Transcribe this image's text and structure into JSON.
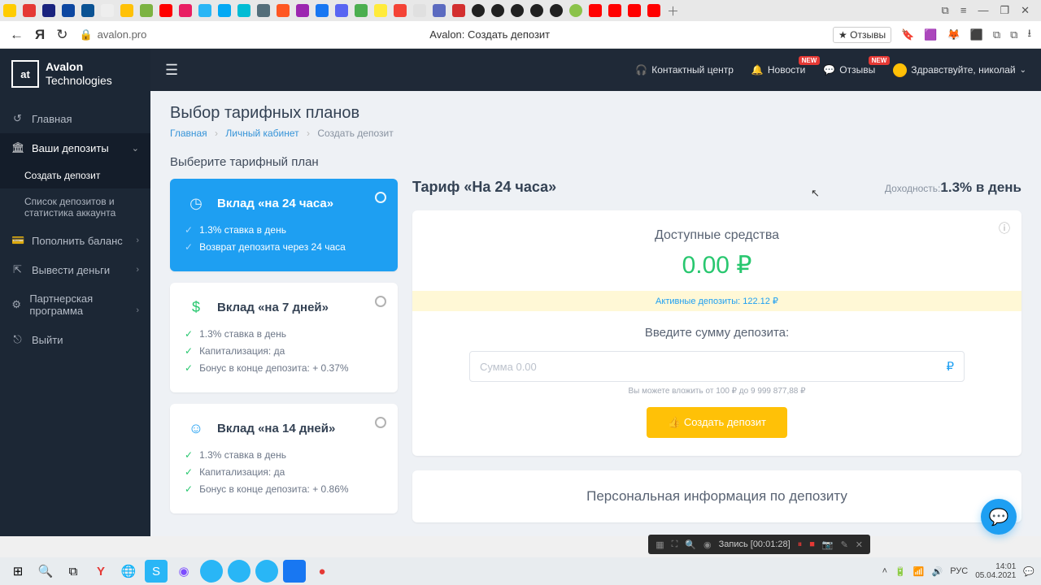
{
  "browser": {
    "address_domain": "avalon.pro",
    "page_title": "Avalon: Создать депозит",
    "reviews_button": "★ Отзывы"
  },
  "app_brand": {
    "line1": "Avalon",
    "line2": "Technologies",
    "logo_text": "at"
  },
  "topbar": {
    "contact": "Контактный центр",
    "news": "Новости",
    "reviews": "Отзывы",
    "badge": "NEW",
    "greeting": "Здравствуйте, николай"
  },
  "sidebar": {
    "home": "Главная",
    "deposits": "Ваши депозиты",
    "create_deposit": "Создать депозит",
    "deposit_list": "Список депозитов и статистика аккаунта",
    "topup": "Пополнить баланс",
    "withdraw": "Вывести деньги",
    "partner": "Партнерская программа",
    "logout": "Выйти"
  },
  "page": {
    "h1": "Выбор тарифных планов",
    "bc_home": "Главная",
    "bc_cabinet": "Личный кабинет",
    "bc_current": "Создать депозит",
    "section_label": "Выберите тарифный план"
  },
  "plans": [
    {
      "title": "Вклад «на 24 часа»",
      "features": [
        "1.3% ставка в день",
        "Возврат депозита через 24 часа"
      ]
    },
    {
      "title": "Вклад «на 7 дней»",
      "features": [
        "1.3% ставка в день",
        "Капитализация: да",
        "Бонус в конце депозита: + 0.37%"
      ]
    },
    {
      "title": "Вклад «на 14 дней»",
      "features": [
        "1.3% ставка в день",
        "Капитализация: да",
        "Бонус в конце депозита: + 0.86%"
      ]
    }
  ],
  "detail": {
    "tariff_title": "Тариф «На 24 часа»",
    "profit_label": "Доходность:",
    "profit_value": "1.3% в день",
    "funds_label": "Доступные средства",
    "funds_amount": "0.00 ₽",
    "active_label": "Активные депозиты: ",
    "active_value": "122.12 ₽",
    "input_label": "Введите сумму депозита:",
    "placeholder": "Сумма 0.00",
    "hint": "Вы можете вложить от 100 ₽ до 9 999 877,88 ₽",
    "create_btn": "👍 Создать депозит",
    "personal_title": "Персональная информация по депозиту"
  },
  "recorder": {
    "label": "Запись [00:01:28]"
  },
  "tray": {
    "lang": "РУС",
    "time": "14:01",
    "date": "05.04.2021"
  }
}
